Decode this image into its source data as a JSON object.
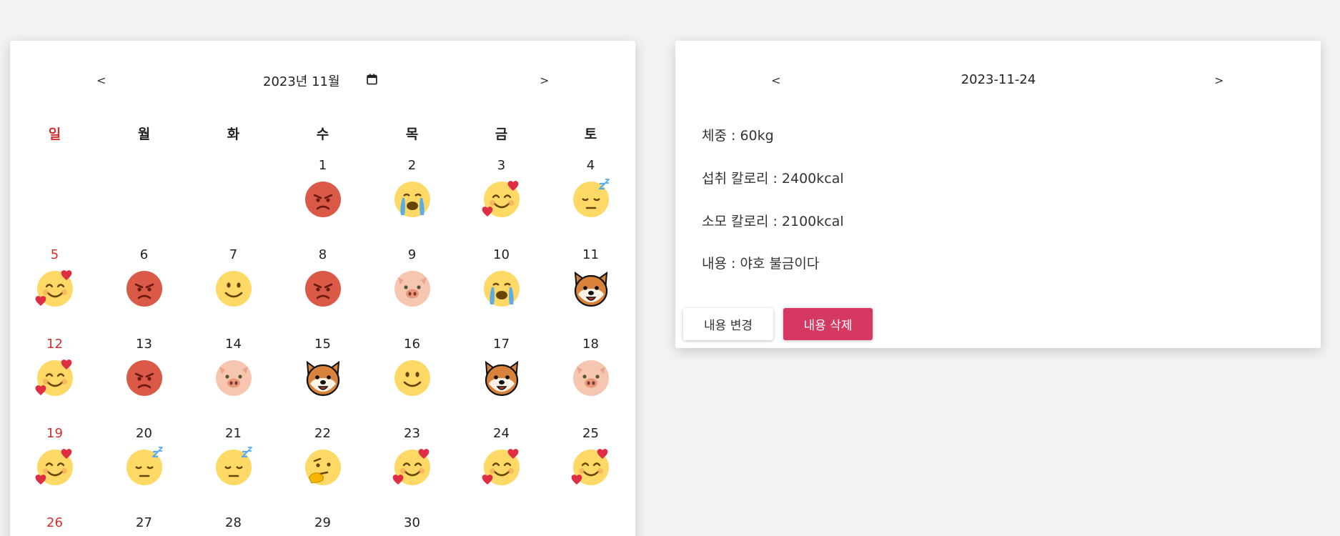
{
  "calendar": {
    "prev_label": "<",
    "next_label": ">",
    "month_title": "2023년 11월",
    "weekdays": [
      "일",
      "월",
      "화",
      "수",
      "목",
      "금",
      "토"
    ],
    "first_weekday_index": 3,
    "days": [
      {
        "day": "1",
        "mood": "angry"
      },
      {
        "day": "2",
        "mood": "crying"
      },
      {
        "day": "3",
        "mood": "love"
      },
      {
        "day": "4",
        "mood": "sleepy"
      },
      {
        "day": "5",
        "mood": "love"
      },
      {
        "day": "6",
        "mood": "angry"
      },
      {
        "day": "7",
        "mood": "smile"
      },
      {
        "day": "8",
        "mood": "angry"
      },
      {
        "day": "9",
        "mood": "pig"
      },
      {
        "day": "10",
        "mood": "crying"
      },
      {
        "day": "11",
        "mood": "dog"
      },
      {
        "day": "12",
        "mood": "love"
      },
      {
        "day": "13",
        "mood": "angry"
      },
      {
        "day": "14",
        "mood": "pig"
      },
      {
        "day": "15",
        "mood": "dog"
      },
      {
        "day": "16",
        "mood": "smile"
      },
      {
        "day": "17",
        "mood": "dog"
      },
      {
        "day": "18",
        "mood": "pig"
      },
      {
        "day": "19",
        "mood": "love"
      },
      {
        "day": "20",
        "mood": "sleepy"
      },
      {
        "day": "21",
        "mood": "sleepy"
      },
      {
        "day": "22",
        "mood": "thinking"
      },
      {
        "day": "23",
        "mood": "love"
      },
      {
        "day": "24",
        "mood": "love"
      },
      {
        "day": "25",
        "mood": "love"
      },
      {
        "day": "26",
        "mood": ""
      },
      {
        "day": "27",
        "mood": ""
      },
      {
        "day": "28",
        "mood": ""
      },
      {
        "day": "29",
        "mood": ""
      },
      {
        "day": "30",
        "mood": ""
      }
    ]
  },
  "detail": {
    "prev_label": "<",
    "next_label": ">",
    "date": "2023-11-24",
    "weight": "체중 : 60kg",
    "intake": "섭취 칼로리 : 2400kcal",
    "burned": "소모 칼로리 : 2100kcal",
    "content": "내용 : 야호 불금이다",
    "edit_label": "내용 변경",
    "delete_label": "내용 삭제"
  },
  "colors": {
    "sunday": "#d32f2f",
    "delete_button": "#d63864",
    "background": "#f3f3f3"
  }
}
